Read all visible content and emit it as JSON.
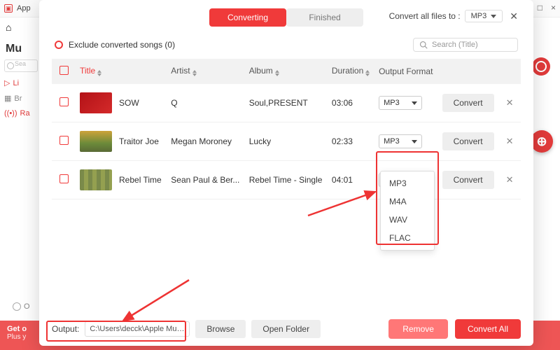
{
  "bg": {
    "app_name": "App",
    "brand": "Mu",
    "search_placeholder": "Sea",
    "side_items": {
      "li": "Li",
      "br": "Br",
      "ra": "Ra"
    },
    "bottom_o_text": "O",
    "promo_l1": "Get o",
    "promo_l2": "Plus y",
    "win_min": "—",
    "win_max": "□",
    "win_close": "×"
  },
  "tabs": {
    "converting": "Converting",
    "finished": "Finished"
  },
  "top_right": {
    "convert_all_label": "Convert all files to :",
    "selected_format": "MP3"
  },
  "exclude": {
    "label": "Exclude converted songs (0)"
  },
  "search": {
    "placeholder": "Search  (Title)"
  },
  "columns": {
    "title": "Title",
    "artist": "Artist",
    "album": "Album",
    "duration": "Duration",
    "output_format": "Output Format"
  },
  "rows": [
    {
      "title": "SOW",
      "artist": "Q",
      "album": "Soul,PRESENT",
      "duration": "03:06",
      "format": "MP3",
      "convert": "Convert"
    },
    {
      "title": "Traitor Joe",
      "artist": "Megan Moroney",
      "album": "Lucky",
      "duration": "02:33",
      "format": "MP3",
      "convert": "Convert"
    },
    {
      "title": "Rebel Time",
      "artist": "Sean Paul & Ber...",
      "album": "Rebel Time - Single",
      "duration": "04:01",
      "format": "MP3",
      "convert": "Convert"
    }
  ],
  "dropdown_options": {
    "o0": "MP3",
    "o1": "M4A",
    "o2": "WAV",
    "o3": "FLAC"
  },
  "footer": {
    "output_label": "Output:",
    "output_path": "C:\\Users\\decck\\Apple Music...",
    "browse": "Browse",
    "open_folder": "Open Folder",
    "remove": "Remove",
    "convert_all": "Convert All"
  }
}
